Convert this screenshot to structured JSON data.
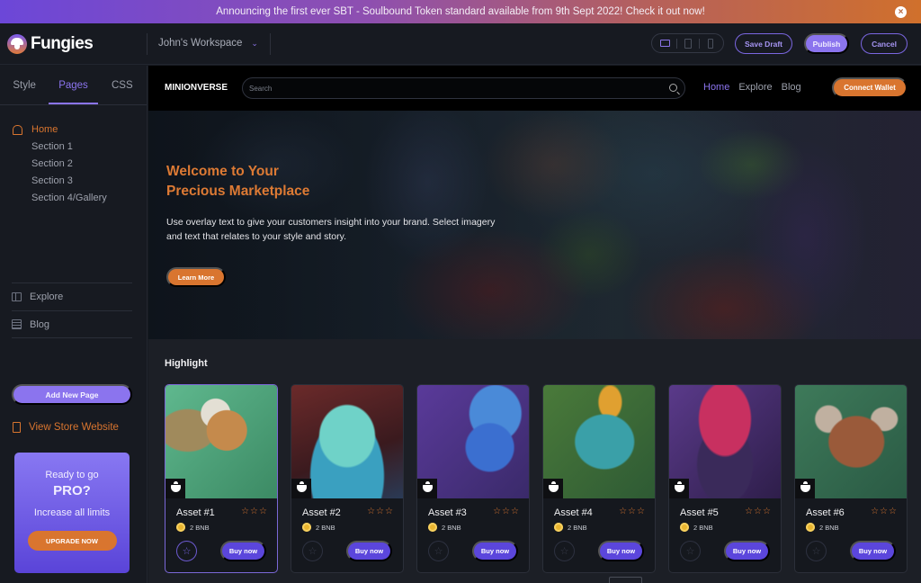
{
  "banner": {
    "text": "Announcing the first ever SBT - Soulbound Token standard available from 9th Sept 2022! Check it out now!",
    "close_icon": "close-icon"
  },
  "topbar": {
    "logo": "Fungies",
    "workspace": "John's Workspace",
    "devices": [
      "desktop",
      "tablet",
      "mobile"
    ],
    "active_device": "desktop",
    "save_draft": "Save Draft",
    "publish": "Publish",
    "cancel": "Cancel"
  },
  "colors": {
    "accent": "#8b74ee",
    "orange": "#d9752f",
    "buy": "#5b46dc",
    "bg": "#171a21"
  },
  "sidebar": {
    "tabs": [
      {
        "label": "Style"
      },
      {
        "label": "Pages",
        "active": true
      },
      {
        "label": "CSS"
      }
    ],
    "pages": [
      {
        "label": "Home"
      },
      {
        "label": "Section 1"
      },
      {
        "label": "Section 2"
      },
      {
        "label": "Section 3"
      },
      {
        "label": "Section 4/Gallery"
      }
    ],
    "nav": [
      {
        "label": "Explore",
        "icon": "book-icon"
      },
      {
        "label": "Blog",
        "icon": "document-icon"
      }
    ],
    "add_page": "Add New Page",
    "view_store": "View Store Website",
    "pro": {
      "line1": "Ready to go",
      "line2": "PRO?",
      "line3": "Increase all limits",
      "button": "UPGRADE NOW"
    }
  },
  "site": {
    "brand": "MINIONVERSE",
    "search_placeholder": "Search",
    "links": [
      {
        "label": "Home",
        "active": true
      },
      {
        "label": "Explore"
      },
      {
        "label": "Blog"
      }
    ],
    "connect_wallet": "Connect Wallet",
    "hero": {
      "title_line1": "Welcome to Your",
      "title_line2": "Precious Marketplace",
      "body": "Use overlay text to give your customers insight into your brand. Select imagery and text that relates to your style and story.",
      "button": "Learn More"
    },
    "highlight_title": "Highlight",
    "assets": [
      {
        "name": "Asset #1",
        "price": "2 BNB",
        "rating": 0,
        "stars_max": 3,
        "buy": "Buy now",
        "selected": true,
        "art": "griffin"
      },
      {
        "name": "Asset #2",
        "price": "2 BNB",
        "rating": 0,
        "stars_max": 3,
        "buy": "Buy now",
        "art": "stone-goblin"
      },
      {
        "name": "Asset #3",
        "price": "2 BNB",
        "rating": 0,
        "stars_max": 3,
        "buy": "Buy now",
        "art": "blue-skull"
      },
      {
        "name": "Asset #4",
        "price": "2 BNB",
        "rating": 0,
        "stars_max": 3,
        "buy": "Buy now",
        "art": "lizard"
      },
      {
        "name": "Asset #5",
        "price": "2 BNB",
        "rating": 0,
        "stars_max": 3,
        "buy": "Buy now",
        "art": "red-hair-warrior"
      },
      {
        "name": "Asset #6",
        "price": "2 BNB",
        "rating": 0,
        "stars_max": 3,
        "buy": "Buy now",
        "art": "minotaur"
      }
    ]
  }
}
